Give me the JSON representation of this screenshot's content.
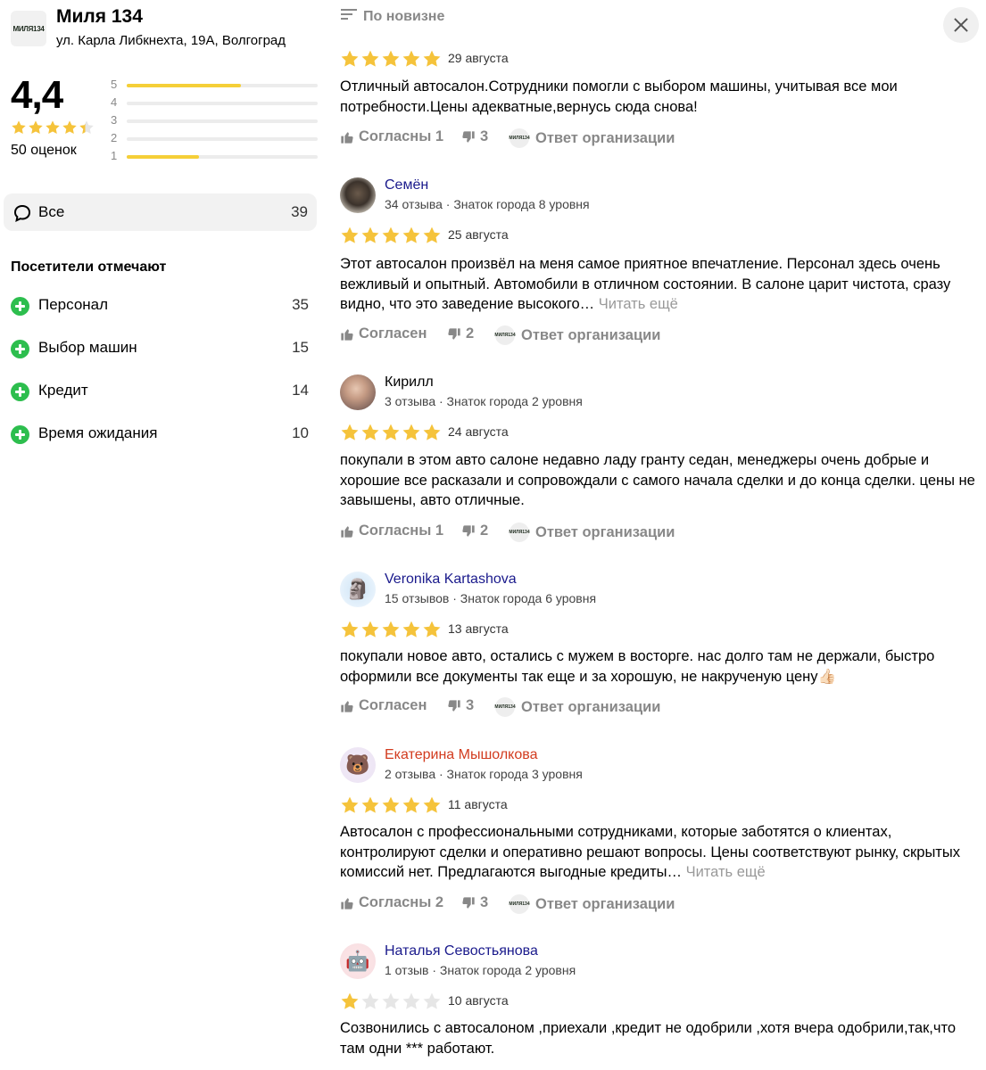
{
  "org": {
    "name": "Миля 134",
    "address": "ул. Карла Либкнехта, 19А, Волгоград",
    "logo_text": "МИЛЯ134"
  },
  "rating": {
    "value": "4,4",
    "stars_fraction": 0.88,
    "count_label": "50 оценок",
    "distribution": [
      {
        "label": "5",
        "fraction": 0.6
      },
      {
        "label": "4",
        "fraction": 0.0
      },
      {
        "label": "3",
        "fraction": 0.0
      },
      {
        "label": "2",
        "fraction": 0.0
      },
      {
        "label": "1",
        "fraction": 0.38
      }
    ]
  },
  "tabs": {
    "all_label": "Все",
    "all_count": "39"
  },
  "visitors": {
    "title": "Посетители отмечают",
    "items": [
      {
        "label": "Персонал",
        "count": "35"
      },
      {
        "label": "Выбор машин",
        "count": "15"
      },
      {
        "label": "Кредит",
        "count": "14"
      },
      {
        "label": "Время ожидания",
        "count": "10"
      }
    ]
  },
  "sort": {
    "label": "По новизне"
  },
  "actions": {
    "reply_label": "Ответ организации",
    "read_more": "Читать ещё"
  },
  "colors": {
    "star": "#f5c33b",
    "star_empty": "#e6e6e6",
    "plus": "#2dbe4e",
    "link": "#1a1a8c",
    "accent_name": "#d23b1e"
  },
  "reviews": [
    {
      "author": "",
      "meta": "",
      "stars": 5,
      "date": "29 августа",
      "text": "Отличный автосалон.Сотрудники помогли с выбором машины, учитывая все мои потребности.Цены адекватные,вернусь сюда снова!",
      "more": "",
      "agree": "Согласны 1",
      "disagree": "3"
    },
    {
      "author": "Семён",
      "meta": "34 отзыва · Знаток города 8 уровня",
      "stars": 5,
      "date": "25 августа",
      "text": "Этот автосалон произвёл на меня самое приятное впечатление. Персонал здесь очень вежливый и опытный. Автомобили в отличном состоянии. В салоне царит чистота, сразу видно, что это заведение высокого…",
      "more": "Читать ещё",
      "agree": "Согласен",
      "disagree": "2"
    },
    {
      "author": "Кирилл",
      "meta": "3 отзыва · Знаток города 2 уровня",
      "stars": 5,
      "date": "24 августа",
      "text": "покупали в этом авто салоне недавно ладу гранту седан, менеджеры очень добрые и хорошие все расказали и сопровождали с самого начала сделки и до конца сделки. цены не завышены, авто отличные.",
      "more": "",
      "agree": "Согласны 1",
      "disagree": "2"
    },
    {
      "author": "Veronika Kartashova",
      "meta": "15 отзывов · Знаток города 6 уровня",
      "stars": 5,
      "date": "13 августа",
      "text": "покупали новое авто, остались с мужем в восторге. нас долго там не держали, быстро оформили все документы так еще и за хорошую, не накрученую цену👍🏻",
      "more": "",
      "agree": "Согласен",
      "disagree": "3"
    },
    {
      "author": "Екатерина Мышолкова",
      "meta": "2 отзыва · Знаток города 3 уровня",
      "stars": 5,
      "date": "11 августа",
      "text": "Автосалон с профессиональными сотрудниками, которые заботятся о клиентах, контролируют сделки и оперативно решают вопросы. Цены соответствуют рынку, скрытых комиссий нет. Предлагаются выгодные кредиты…",
      "more": "Читать ещё",
      "agree": "Согласны 2",
      "disagree": "3"
    },
    {
      "author": "Наталья Севостьянова",
      "meta": "1 отзыв · Знаток города 2 уровня",
      "stars": 1,
      "date": "10 августа",
      "text": "Созвонились с автосалоном ,приехали ,кредит не одобрили ,хотя вчера одобрили,так,что там одни *** работают.",
      "more": "",
      "agree": "",
      "disagree": ""
    }
  ]
}
